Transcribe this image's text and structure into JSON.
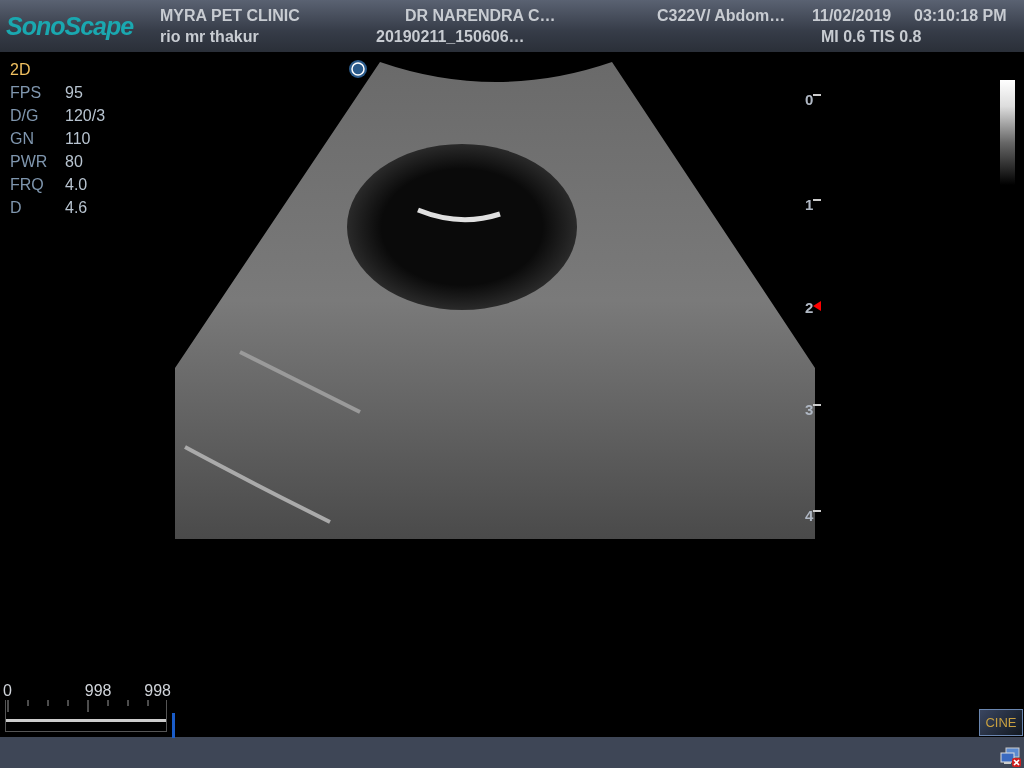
{
  "header": {
    "logo": "SonoScape",
    "clinic": "MYRA PET CLINIC",
    "doctor": "DR NARENDRA C…",
    "probe": "C322V/ Abdom…",
    "date": "11/02/2019",
    "time": "03:10:18 PM",
    "patient": "rio mr thakur",
    "study_id": "20190211_150606…",
    "indices": "MI 0.6 TIS 0.8"
  },
  "mode": "2D",
  "parameters": [
    {
      "label": "FPS",
      "value": "95"
    },
    {
      "label": "D/G",
      "value": "120/3"
    },
    {
      "label": "GN",
      "value": "110"
    },
    {
      "label": "PWR",
      "value": "80"
    },
    {
      "label": "FRQ",
      "value": "4.0"
    },
    {
      "label": "D",
      "value": "4.6"
    }
  ],
  "depth_scale": [
    {
      "label": "0",
      "focus": false
    },
    {
      "label": "1",
      "focus": false
    },
    {
      "label": "2",
      "focus": true
    },
    {
      "label": "3",
      "focus": false
    },
    {
      "label": "4",
      "focus": false
    }
  ],
  "cine": {
    "start": "0",
    "current": "998",
    "end": "998",
    "level": 1.0,
    "button": "CINE"
  }
}
